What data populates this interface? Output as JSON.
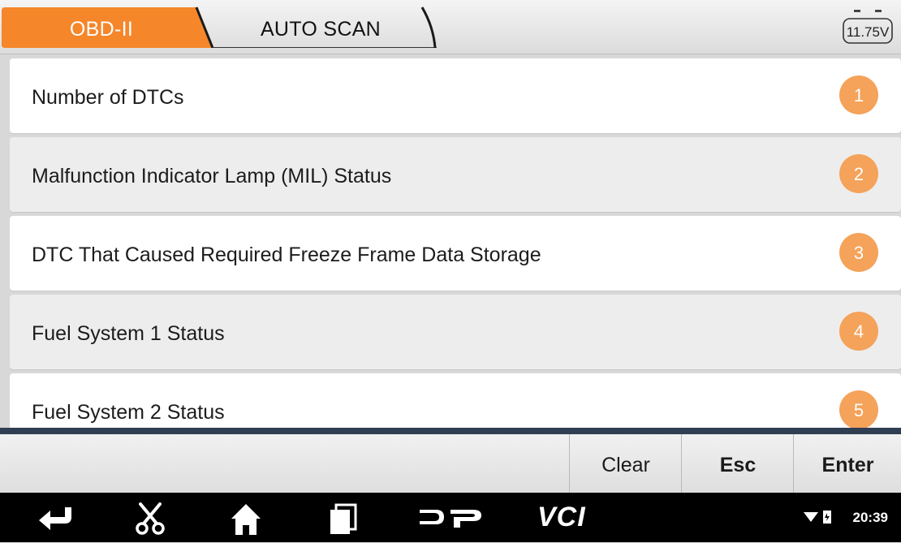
{
  "tabs": [
    {
      "label": "OBD-II",
      "active": true
    },
    {
      "label": "AUTO SCAN",
      "active": false
    }
  ],
  "battery": {
    "voltage": "11.75V",
    "icon": "battery-icon"
  },
  "list": {
    "items": [
      {
        "label": "Number of DTCs",
        "number": "1"
      },
      {
        "label": "Malfunction Indicator Lamp (MIL) Status",
        "number": "2"
      },
      {
        "label": "DTC That Caused Required Freeze Frame Data Storage",
        "number": "3"
      },
      {
        "label": "Fuel System 1 Status",
        "number": "4"
      },
      {
        "label": "Fuel System 2 Status",
        "number": "5"
      }
    ]
  },
  "actions": {
    "clear": "Clear",
    "esc": "Esc",
    "enter": "Enter"
  },
  "navbar": {
    "icons": [
      "back-icon",
      "scissors-icon",
      "home-icon",
      "recent-apps-icon",
      "dp-logo-icon"
    ],
    "vci_label": "VCI",
    "time": "20:39"
  },
  "colors": {
    "accent": "#f5862a",
    "badge": "#f5a25a",
    "divider": "#2f3e52"
  }
}
